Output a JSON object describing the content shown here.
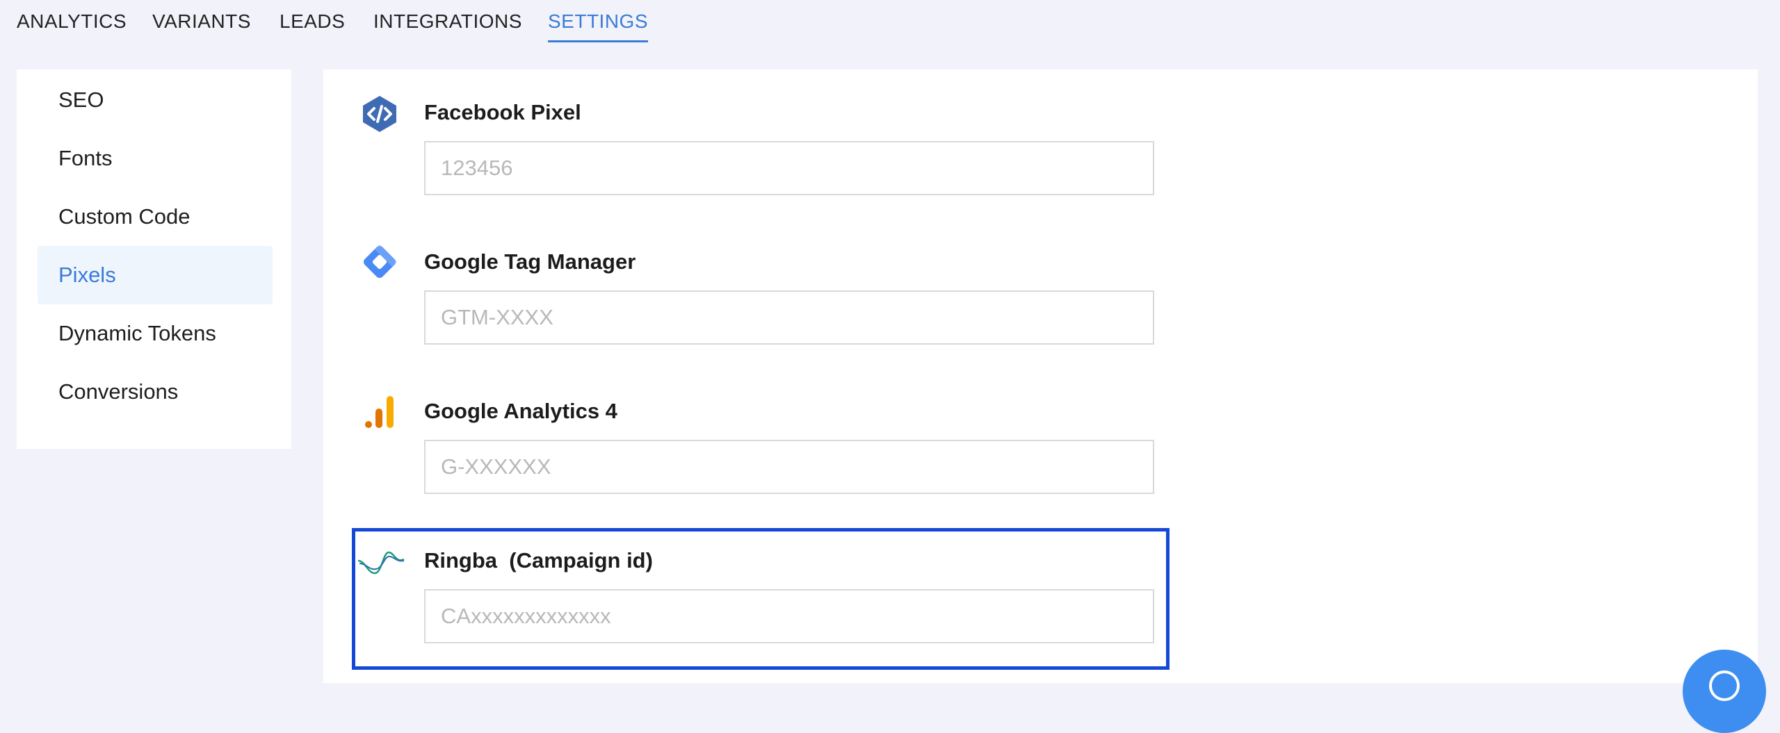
{
  "tabs": [
    {
      "label": "ANALYTICS"
    },
    {
      "label": "VARIANTS"
    },
    {
      "label": "LEADS"
    },
    {
      "label": "INTEGRATIONS"
    },
    {
      "label": "SETTINGS"
    }
  ],
  "active_tab": "SETTINGS",
  "sidebar": {
    "items": [
      {
        "label": "SEO"
      },
      {
        "label": "Fonts"
      },
      {
        "label": "Custom Code"
      },
      {
        "label": "Pixels"
      },
      {
        "label": "Dynamic Tokens"
      },
      {
        "label": "Conversions"
      }
    ],
    "active": "Pixels"
  },
  "pixels": [
    {
      "label": "Facebook Pixel",
      "placeholder": "123456",
      "value": "",
      "icon": "code-icon"
    },
    {
      "label": "Google Tag Manager",
      "placeholder": "GTM-XXXX",
      "value": "",
      "icon": "google-tag-manager-icon"
    },
    {
      "label": "Google Analytics 4",
      "placeholder": "G-XXXXXX",
      "value": "",
      "icon": "google-analytics-icon"
    },
    {
      "label": "Ringba  (Campaign id)",
      "placeholder": "CAxxxxxxxxxxxxx",
      "value": "",
      "icon": "ringba-wave-icon"
    }
  ],
  "colors": {
    "accent": "#3a7bd5",
    "highlight_border": "#1448d6",
    "background": "#f2f3fa"
  }
}
